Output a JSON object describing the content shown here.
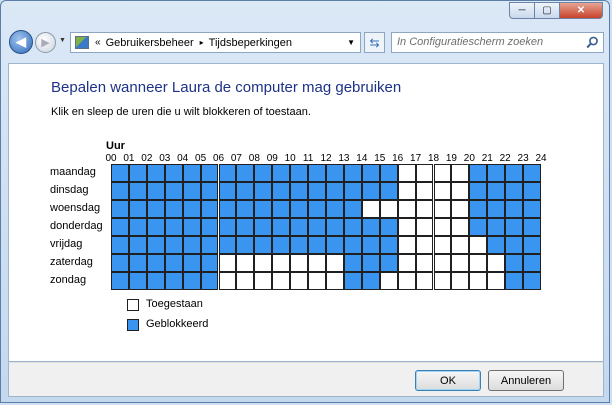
{
  "window": {
    "controls": {
      "minimize": "─",
      "maximize": "▢",
      "close": "✕"
    }
  },
  "navigation": {
    "back_icon": "arrow-left-icon",
    "forward_icon": "arrow-right-icon",
    "address": {
      "chevron": "«",
      "crumbs": [
        "Gebruikersbeheer",
        "Tijdsbeperkingen"
      ],
      "separator": "▸",
      "dropdown": "▼"
    },
    "refresh_icon": "refresh-icon",
    "search": {
      "placeholder": "In Configuratiescherm zoeken"
    }
  },
  "page": {
    "title": "Bepalen wanneer Laura de computer mag gebruiken",
    "instruction": "Klik en sleep de uren die u wilt blokkeren of toestaan."
  },
  "schedule": {
    "hour_header": "Uur",
    "hours": [
      "00",
      "01",
      "02",
      "03",
      "04",
      "05",
      "06",
      "07",
      "08",
      "09",
      "10",
      "11",
      "12",
      "13",
      "14",
      "15",
      "16",
      "17",
      "18",
      "19",
      "20",
      "21",
      "22",
      "23",
      "24"
    ],
    "days": [
      "maandag",
      "dinsdag",
      "woensdag",
      "donderdag",
      "vrijdag",
      "zaterdag",
      "zondag"
    ],
    "blocked_hours": [
      [
        0,
        1,
        2,
        3,
        4,
        5,
        6,
        7,
        8,
        9,
        10,
        11,
        12,
        13,
        14,
        15,
        20,
        21,
        22,
        23
      ],
      [
        0,
        1,
        2,
        3,
        4,
        5,
        6,
        7,
        8,
        9,
        10,
        11,
        12,
        13,
        14,
        15,
        20,
        21,
        22,
        23
      ],
      [
        0,
        1,
        2,
        3,
        4,
        5,
        6,
        7,
        8,
        9,
        10,
        11,
        12,
        13,
        20,
        21,
        22,
        23
      ],
      [
        0,
        1,
        2,
        3,
        4,
        5,
        6,
        7,
        8,
        9,
        10,
        11,
        12,
        13,
        14,
        15,
        20,
        21,
        22,
        23
      ],
      [
        0,
        1,
        2,
        3,
        4,
        5,
        6,
        7,
        8,
        9,
        10,
        11,
        12,
        13,
        14,
        15,
        21,
        22,
        23
      ],
      [
        0,
        1,
        2,
        3,
        4,
        5,
        13,
        14,
        15,
        22,
        23
      ],
      [
        0,
        1,
        2,
        3,
        4,
        5,
        13,
        14,
        22,
        23
      ]
    ]
  },
  "legend": {
    "allowed": "Toegestaan",
    "blocked": "Geblokkeerd"
  },
  "colors": {
    "allowed": "#ffffff",
    "blocked": "#3a95f0",
    "title": "#1e3287"
  },
  "buttons": {
    "ok": "OK",
    "cancel": "Annuleren"
  }
}
